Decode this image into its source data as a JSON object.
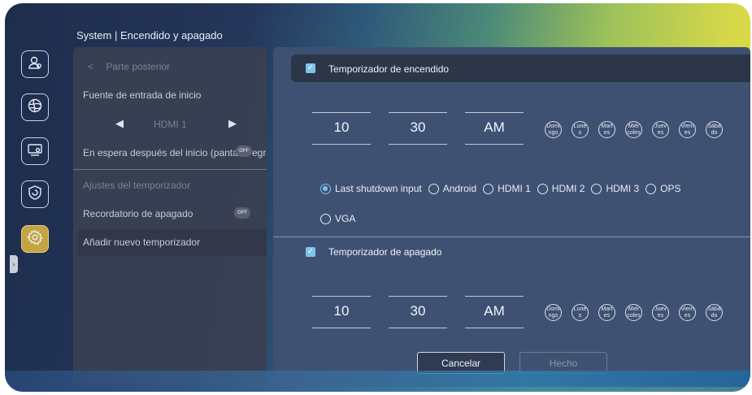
{
  "header": {
    "title": "System | Encendido y apagado"
  },
  "sidebar": {
    "items": [
      {
        "icon": "user-icon",
        "active": false
      },
      {
        "icon": "globe-icon",
        "active": false
      },
      {
        "icon": "display-settings-icon",
        "active": false
      },
      {
        "icon": "shield-icon",
        "active": false
      },
      {
        "icon": "gear-icon",
        "active": true
      }
    ]
  },
  "list_panel": {
    "back_label": "Parte posterior",
    "input_source_label": "Fuente de entrada de inicio",
    "input_source_value": "HDMI 1",
    "standby_label": "En espera después del inicio (pantall",
    "standby_label_tail": "egra",
    "standby_toggle": "OFF",
    "timer_settings_label": "Ajustes del temporizador",
    "shutdown_reminder_label": "Recordatorio de apagado",
    "shutdown_reminder_toggle": "OFF",
    "add_timer_label": "Añadir nuevo temporizador"
  },
  "power_on": {
    "label": "Temporizador de encendido",
    "checked": true,
    "hour": "10",
    "minute": "30",
    "ampm": "AM",
    "days": [
      "Domingo",
      "Lunes",
      "Martes",
      "Miércoles",
      "Jueves",
      "Viernes",
      "Sábado"
    ],
    "sources": [
      {
        "label": "Last shutdown input",
        "selected": true
      },
      {
        "label": "Android",
        "selected": false
      },
      {
        "label": "HDMI 1",
        "selected": false
      },
      {
        "label": "HDMI 2",
        "selected": false
      },
      {
        "label": "HDMI 3",
        "selected": false
      },
      {
        "label": "OPS",
        "selected": false
      },
      {
        "label": "VGA",
        "selected": false
      }
    ]
  },
  "power_off": {
    "label": "Temporizador de apagado",
    "checked": true,
    "hour": "10",
    "minute": "30",
    "ampm": "AM",
    "days": [
      "Domingo",
      "Lunes",
      "Martes",
      "Miércoles",
      "Jueves",
      "Viernes",
      "Sábado"
    ]
  },
  "actions": {
    "cancel_label": "Cancelar",
    "done_label": "Hecho"
  },
  "colors": {
    "accent": "#7cc4ea",
    "active_tile": "#c5a441"
  }
}
